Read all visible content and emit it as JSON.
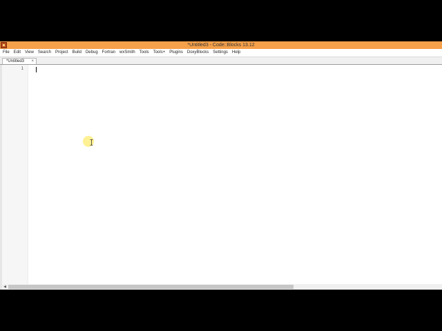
{
  "window": {
    "title": "*Untitled3 - Code::Blocks 13.12",
    "controls": "– □ ✕"
  },
  "menu": {
    "items": [
      "File",
      "Edit",
      "View",
      "Search",
      "Project",
      "Build",
      "Debug",
      "Fortran",
      "wxSmith",
      "Tools",
      "Tools+",
      "Plugins",
      "DoxyBlocks",
      "Settings",
      "Help"
    ]
  },
  "tabs": [
    {
      "label": "*Untitled3",
      "close": "×",
      "active": true
    }
  ],
  "editor": {
    "line_numbers": [
      "1"
    ],
    "content": ""
  },
  "scrollbar": {
    "left_arrow": "◀"
  },
  "colors": {
    "titlebar": "#f5a04a",
    "cursor_highlight": "#ffe63c"
  },
  "icons": {
    "app": "codeblocks-app-icon",
    "cursor": "text-ibeam-cursor-icon"
  }
}
